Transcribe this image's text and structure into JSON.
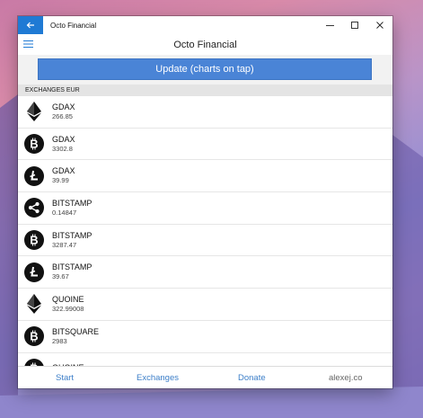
{
  "window": {
    "title": "Octo Financial"
  },
  "header": {
    "title": "Octo Financial"
  },
  "update_button": {
    "label": "Update (charts on tap)"
  },
  "section": {
    "label": "EXCHANGES EUR"
  },
  "exchanges": [
    {
      "name": "GDAX",
      "price": "266.85",
      "coin_icon": "ethereum-icon"
    },
    {
      "name": "GDAX",
      "price": "3302.8",
      "coin_icon": "bitcoin-icon"
    },
    {
      "name": "GDAX",
      "price": "39.99",
      "coin_icon": "litecoin-icon"
    },
    {
      "name": "BITSTAMP",
      "price": "0.14847",
      "coin_icon": "ripple-icon"
    },
    {
      "name": "BITSTAMP",
      "price": "3287.47",
      "coin_icon": "bitcoin-icon"
    },
    {
      "name": "BITSTAMP",
      "price": "39.67",
      "coin_icon": "litecoin-icon"
    },
    {
      "name": "QUOINE",
      "price": "322.99008",
      "coin_icon": "ethereum-icon"
    },
    {
      "name": "BITSQUARE",
      "price": "2983",
      "coin_icon": "bitcoin-icon"
    },
    {
      "name": "QUOINE",
      "price": "",
      "coin_icon": "bitcoin-icon"
    }
  ],
  "bottom_nav": {
    "start": "Start",
    "exchanges": "Exchanges",
    "donate": "Donate",
    "credit": "alexej.co"
  },
  "colors": {
    "accent": "#4a84d6",
    "titlebar_back": "#1f7ad4",
    "nav_link": "#3d7fc9"
  }
}
